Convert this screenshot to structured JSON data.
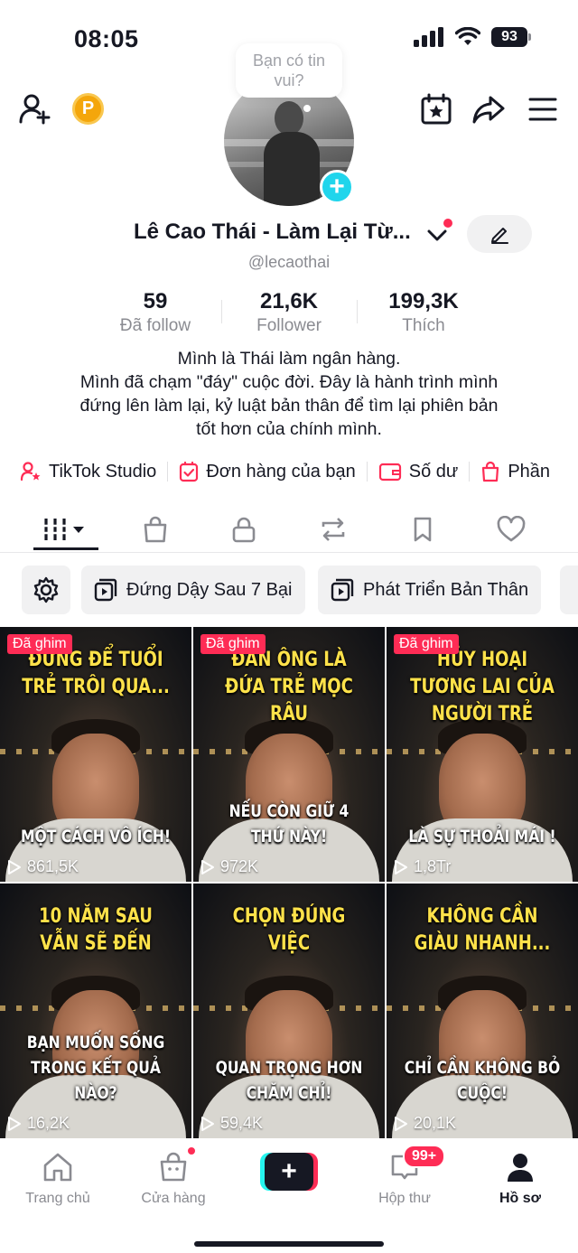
{
  "status_bar": {
    "time": "08:05",
    "battery": "93"
  },
  "profile": {
    "bubble": "Bạn có tin vui?",
    "name": "Lê Cao Thái - Làm Lại Từ...",
    "handle": "@lecaothai",
    "stats": [
      {
        "value": "59",
        "label": "Đã follow"
      },
      {
        "value": "21,6K",
        "label": "Follower"
      },
      {
        "value": "199,3K",
        "label": "Thích"
      }
    ],
    "bio": [
      "Mình là Thái làm ngân hàng.",
      "Mình đã chạm \"đáy\" cuộc đời. Đây là hành trình mình",
      "đứng lên làm lại, kỷ luật bản thân để tìm lại phiên bản",
      "tốt hơn của chính mình."
    ]
  },
  "shortcuts": [
    {
      "label": "TikTok Studio",
      "icon": "studio-icon"
    },
    {
      "label": "Đơn hàng của bạn",
      "icon": "orders-icon"
    },
    {
      "label": "Số dư",
      "icon": "wallet-icon"
    },
    {
      "label": "Phần",
      "icon": "bag-icon"
    }
  ],
  "tabs": [
    "videos-icon",
    "shop-icon",
    "lock-icon",
    "repost-icon",
    "bookmark-icon",
    "heart-icon"
  ],
  "collections": [
    "Đứng Dậy Sau 7 Bại",
    "Phát Triển Bản Thân"
  ],
  "videos": [
    {
      "pinned": "Đã ghim",
      "top": "ĐỪNG ĐỂ TUỔI TRẺ TRÔI QUA...",
      "bottom": "MỘT CÁCH VÔ ÍCH!",
      "views": "861,5K"
    },
    {
      "pinned": "Đã ghim",
      "top": "ĐÀN ÔNG LÀ ĐỨA TRẺ MỌC RÂU",
      "bottom": "NẾU CÒN GIỮ 4 THỨ NÀY!",
      "views": "972K"
    },
    {
      "pinned": "Đã ghim",
      "top": "HỦY HOẠI TƯƠNG LAI CỦA NGƯỜI TRẺ",
      "bottom": "LÀ SỰ THOẢI MÁI !",
      "views": "1,8Tr"
    },
    {
      "pinned": "",
      "top": "10 NĂM SAU VẪN SẼ ĐẾN",
      "bottom": "BẠN MUỐN SỐNG TRONG KẾT QUẢ NÀO?",
      "views": "16,2K"
    },
    {
      "pinned": "",
      "top": "CHỌN ĐÚNG VIỆC",
      "bottom": "QUAN TRỌNG HƠN CHĂM CHỈ!",
      "views": "59,4K"
    },
    {
      "pinned": "",
      "top": "KHÔNG CẦN GIÀU NHANH...",
      "bottom": "CHỈ CẦN KHÔNG BỎ CUỘC!",
      "views": "20,1K"
    }
  ],
  "bottom_nav": {
    "home": "Trang chủ",
    "shop": "Cửa hàng",
    "create": "+",
    "inbox": "Hộp thư",
    "inbox_badge": "99+",
    "profile": "Hồ sơ"
  }
}
